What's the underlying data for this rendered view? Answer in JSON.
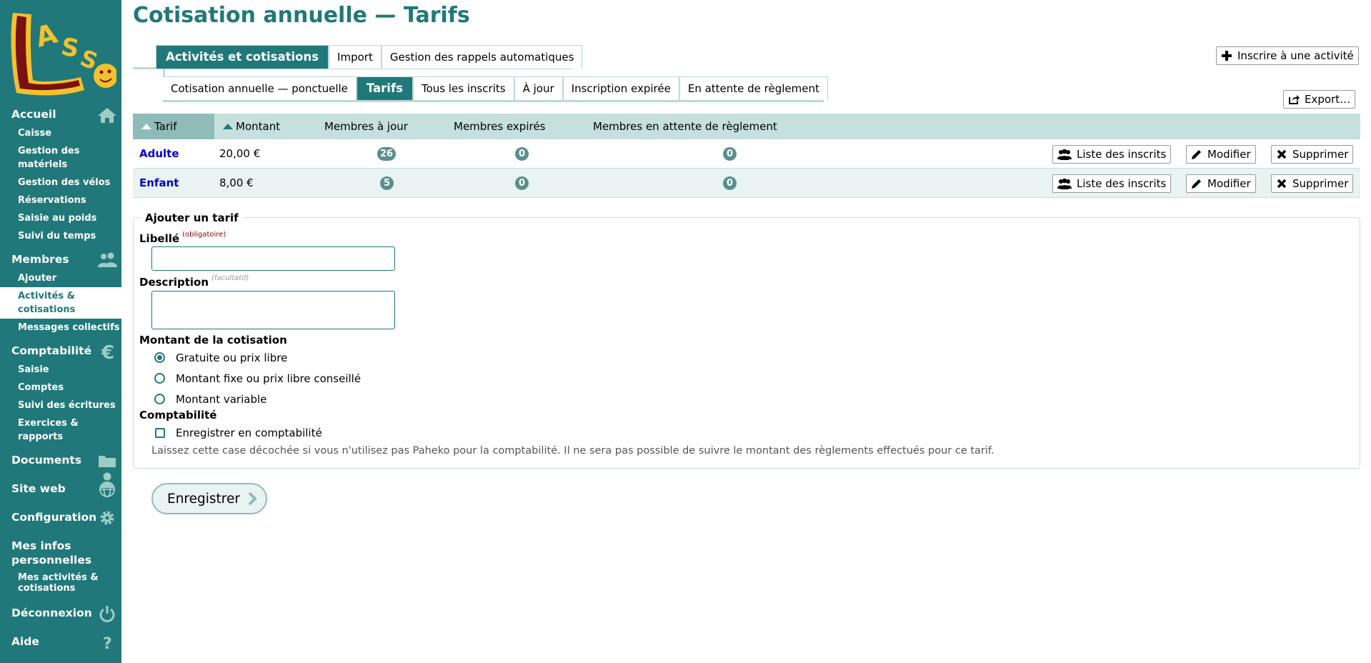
{
  "page_title": "Cotisation annuelle — Tarifs",
  "sidebar": {
    "sections": [
      {
        "label": "Accueil",
        "icon": "home-icon",
        "items": [
          "Caisse",
          "Gestion des matériels",
          "Gestion des vélos",
          "Réservations",
          "Saisie au poids",
          "Suivi du temps"
        ]
      },
      {
        "label": "Membres",
        "icon": "users-icon",
        "items": [
          "Ajouter",
          "Activités & cotisations",
          "Messages collectifs"
        ],
        "active_item": "Activités & cotisations"
      },
      {
        "label": "Comptabilité",
        "icon": "euro-icon",
        "items": [
          "Saisie",
          "Comptes",
          "Suivi des écritures",
          "Exercices & rapports"
        ]
      },
      {
        "label": "Documents",
        "icon": "folder-icon",
        "items": []
      },
      {
        "label": "Site web",
        "icon": "globe-icon",
        "items": []
      },
      {
        "label": "Configuration",
        "icon": "gear-icon",
        "items": []
      },
      {
        "label": "Mes infos personnelles",
        "icon": "user-icon",
        "items": [
          "Mes activités & cotisations"
        ]
      },
      {
        "label": "Déconnexion",
        "icon": "power-icon",
        "items": []
      },
      {
        "label": "Aide",
        "icon": "help-icon",
        "items": []
      }
    ]
  },
  "tabs_main": {
    "items": [
      "Activités et cotisations",
      "Import",
      "Gestion des rappels automatiques"
    ],
    "active": "Activités et cotisations"
  },
  "tabs_sub": {
    "items": [
      "Cotisation annuelle — ponctuelle",
      "Tarifs",
      "Tous les inscrits",
      "À jour",
      "Inscription expirée",
      "En attente de règlement"
    ],
    "active": "Tarifs"
  },
  "buttons": {
    "subscribe": "Inscrire à une activité",
    "export": "Export…"
  },
  "table": {
    "columns": [
      "Tarif",
      "Montant",
      "Membres à jour",
      "Membres expirés",
      "Membres en attente de règlement"
    ],
    "rows": [
      {
        "tarif": "Adulte",
        "montant": "20,00 €",
        "a_jour": "26",
        "expires": "0",
        "attente": "0"
      },
      {
        "tarif": "Enfant",
        "montant": "8,00 €",
        "a_jour": "5",
        "expires": "0",
        "attente": "0"
      }
    ],
    "row_actions": [
      "Liste des inscrits",
      "Modifier",
      "Supprimer"
    ]
  },
  "form": {
    "legend": "Ajouter un tarif",
    "libelle_label": "Libellé",
    "libelle_tag": "(obligatoire)",
    "libelle_value": "",
    "description_label": "Description",
    "description_tag": "(facultatif)",
    "description_value": "",
    "montant_label": "Montant de la cotisation",
    "montant_options": [
      "Gratuite ou prix libre",
      "Montant fixe ou prix libre conseillé",
      "Montant variable"
    ],
    "montant_selected": "Gratuite ou prix libre",
    "compta_label": "Comptabilité",
    "compta_checkbox": "Enregistrer en comptabilité",
    "compta_checked": false,
    "compta_help": "Laissez cette case décochée si vous n'utilisez pas Paheko pour la comptabilité. Il ne sera pas possible de suivre le montant des règlements effectués pour ce tarif.",
    "submit_label": "Enregistrer"
  },
  "colors": {
    "accent": "#20787a",
    "accent_light": "#c5e0dd",
    "link": "#0000cc"
  }
}
